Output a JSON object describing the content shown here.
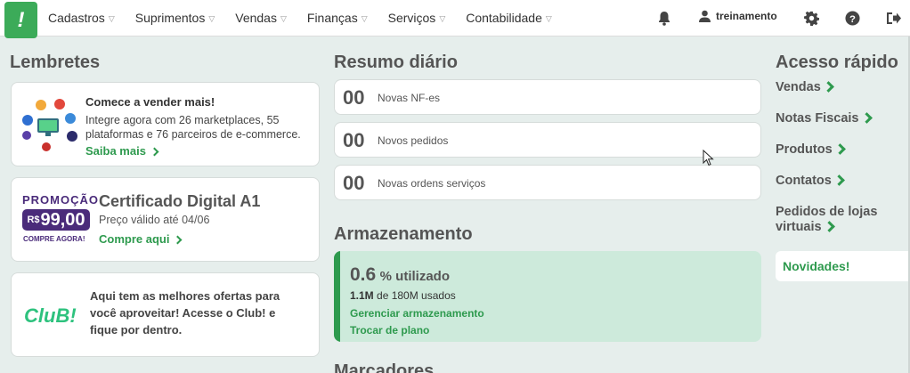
{
  "nav": {
    "items": [
      {
        "label": "Cadastros",
        "name": "nav-cadastros"
      },
      {
        "label": "Suprimentos",
        "name": "nav-suprimentos"
      },
      {
        "label": "Vendas",
        "name": "nav-vendas"
      },
      {
        "label": "Finanças",
        "name": "nav-financas"
      },
      {
        "label": "Serviços",
        "name": "nav-servicos"
      },
      {
        "label": "Contabilidade",
        "name": "nav-contabilidade"
      }
    ],
    "user": "treinamento"
  },
  "lembretes": {
    "title": "Lembretes",
    "marketplace": {
      "title": "Comece a vender mais!",
      "text": "Integre agora com 26 marketplaces, 55 plataformas e 76 parceiros de e-commerce.",
      "link": "Saiba mais"
    },
    "promo": {
      "word": "PROMOÇÃO",
      "currency": "R$",
      "price": "99,00",
      "buy": "COMPRE AGORA!",
      "title": "Certificado Digital A1",
      "sub": "Preço válido até 04/06",
      "link": "Compre aqui"
    },
    "club": {
      "logo": "CluB!",
      "text": "Aqui tem as melhores ofertas para você aproveitar! Acesse o Club! e fique por dentro."
    }
  },
  "resumo": {
    "title": "Resumo diário",
    "items": [
      {
        "num": "00",
        "label": "Novas NF-es"
      },
      {
        "num": "00",
        "label": "Novos pedidos"
      },
      {
        "num": "00",
        "label": "Novas ordens serviços"
      }
    ]
  },
  "storage": {
    "title": "Armazenamento",
    "value": "0.6",
    "unit": "% utilizado",
    "used": "1.1M",
    "used_rest": " de 180M usados",
    "link1": "Gerenciar armazenamento",
    "link2": "Trocar de plano",
    "next_title": "Marcadores"
  },
  "acesso": {
    "title": "Acesso rápido",
    "items": [
      "Vendas",
      "Notas Fiscais",
      "Produtos",
      "Contatos"
    ],
    "lojas_1": "Pedidos de lojas",
    "lojas_2": "virtuais",
    "novidades": "Novidades!"
  },
  "colors": {
    "accent": "#2e9a4e",
    "promo": "#4a2b7a",
    "storage_bg": "#cdeadb"
  }
}
